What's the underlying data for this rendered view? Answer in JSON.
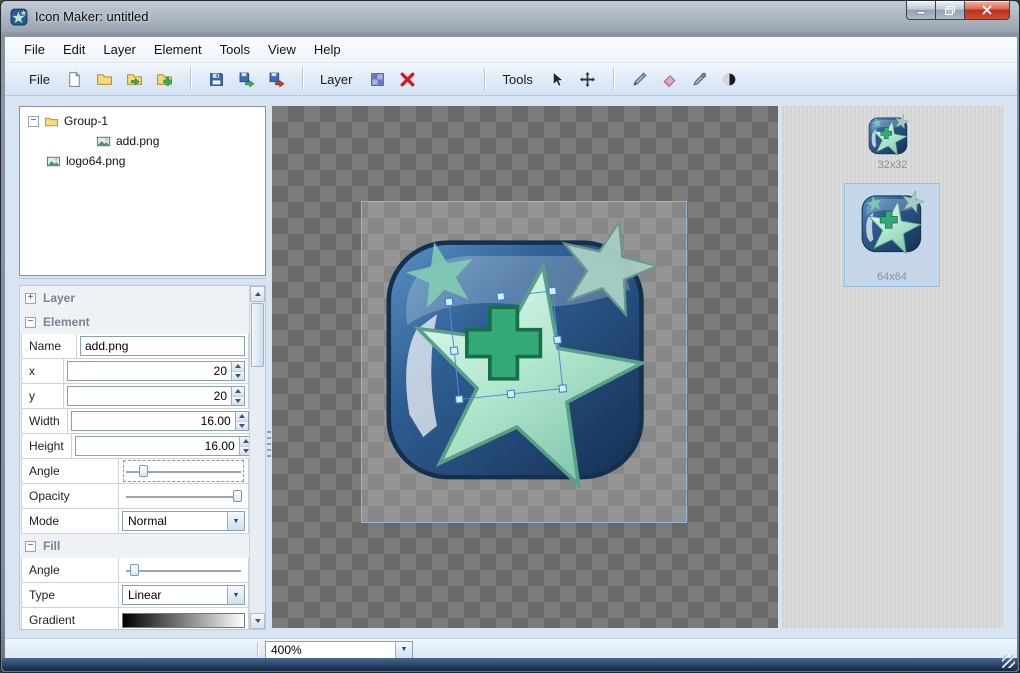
{
  "window": {
    "title": "Icon Maker: untitled"
  },
  "menubar": {
    "items": [
      {
        "label": "File"
      },
      {
        "label": "Edit"
      },
      {
        "label": "Layer"
      },
      {
        "label": "Element"
      },
      {
        "label": "Tools"
      },
      {
        "label": "View"
      },
      {
        "label": "Help"
      }
    ]
  },
  "toolbar": {
    "file_group_label": "File",
    "layer_group_label": "Layer",
    "tools_group_label": "Tools"
  },
  "tree": {
    "items": [
      {
        "label": "Group-1"
      },
      {
        "label": "add.png"
      },
      {
        "label": "logo64.png"
      }
    ]
  },
  "properties": {
    "sections": {
      "layer": "Layer",
      "element": "Element",
      "fill": "Fill"
    },
    "element": {
      "name_label": "Name",
      "name_value": "add.png",
      "x_label": "x",
      "x_value": "20",
      "y_label": "y",
      "y_value": "20",
      "width_label": "Width",
      "width_value": "16.00",
      "height_label": "Height",
      "height_value": "16.00",
      "angle_label": "Angle",
      "opacity_label": "Opacity",
      "mode_label": "Mode",
      "mode_value": "Normal"
    },
    "fill": {
      "angle_label": "Angle",
      "type_label": "Type",
      "type_value": "Linear",
      "gradient_label": "Gradient"
    }
  },
  "previews": {
    "small_label": "32x32",
    "large_label": "64x64"
  },
  "statusbar": {
    "zoom_value": "400%"
  },
  "icons": {
    "collapse_box": "−",
    "expand_box": "+",
    "combo_arrow": "▼"
  },
  "colors": {
    "selection_border": "#8db9e0",
    "toolbar_bg": "#e0ebf8",
    "canvas_checker_dark": "#696969",
    "canvas_checker_light": "#7b7b7b",
    "icon_blue": "#2f5f94",
    "star_teal": "#b2e6cf",
    "plus_green": "#35a878",
    "close_button_red": "#b9331f"
  }
}
